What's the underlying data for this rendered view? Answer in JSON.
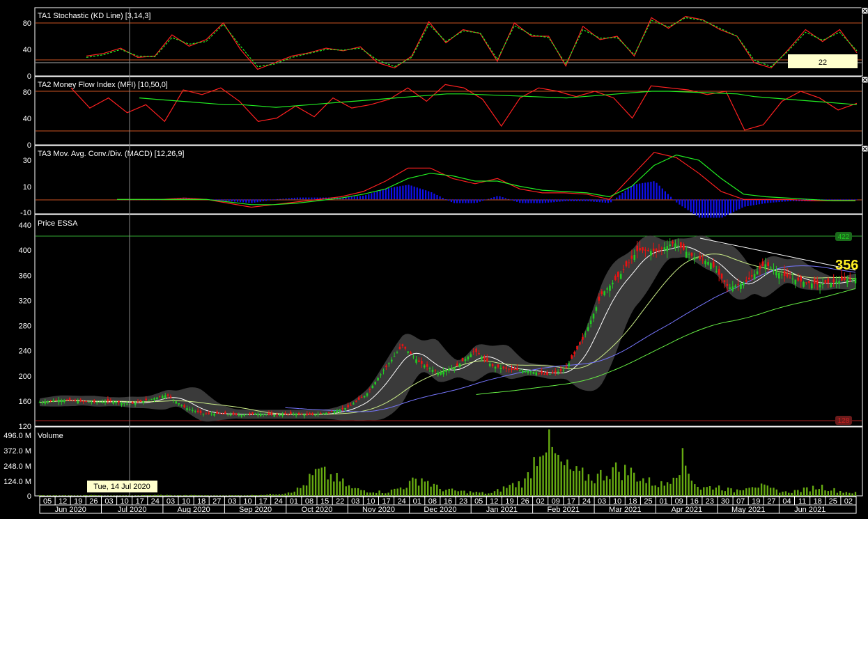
{
  "panels": {
    "stoch": {
      "title": "TA1 Stochastic (KD Line) [3,14,3]",
      "ticks": [
        "80",
        "40",
        "0"
      ],
      "readout": "22"
    },
    "mfi": {
      "title": "TA2 Money Flow Index (MFI) [10,50,0]",
      "ticks": [
        "80",
        "40",
        "0"
      ]
    },
    "macd": {
      "title": "TA3 Mov. Avg. Conv./Div. (MACD) [12,26,9]",
      "ticks": [
        "30",
        "10",
        "-10"
      ]
    },
    "price": {
      "title": "Price ESSA",
      "ticks": [
        "440",
        "400",
        "360",
        "320",
        "280",
        "240",
        "200",
        "160",
        "120"
      ],
      "badge_high": "422",
      "badge_low": "128",
      "last": "356"
    },
    "volume": {
      "title": "Volume",
      "ticks": [
        "496.0 M",
        "372.0 M",
        "248.0 M",
        "124.0 M",
        "0"
      ]
    }
  },
  "crosshair_label": "Tue, 14 Jul 2020",
  "xaxis": {
    "days": [
      "05",
      "12",
      "19",
      "26",
      "03",
      "10",
      "17",
      "24",
      "03",
      "10",
      "18",
      "27",
      "03",
      "10",
      "17",
      "24",
      "01",
      "08",
      "15",
      "22",
      "03",
      "10",
      "17",
      "24",
      "01",
      "08",
      "16",
      "23",
      "05",
      "12",
      "19",
      "26",
      "02",
      "09",
      "17",
      "24",
      "03",
      "10",
      "18",
      "25",
      "01",
      "09",
      "16",
      "23",
      "30",
      "07",
      "19",
      "27",
      "04",
      "11",
      "18",
      "25",
      "02"
    ],
    "months": [
      "Jun 2020",
      "Jul 2020",
      "Aug 2020",
      "Sep 2020",
      "Oct 2020",
      "Nov 2020",
      "Dec 2020",
      "Jan 2021",
      "Feb 2021",
      "Mar 2021",
      "Apr 2021",
      "May 2021",
      "Jun 2021"
    ]
  },
  "colors": {
    "up": "#22cc22",
    "down": "#ee1111",
    "k": "#ff2020",
    "d": "#22ee22",
    "hist": "#1010ee",
    "band": "#444444",
    "ma_white": "#ffffff",
    "ma_green": "#66ee44",
    "ma_blue": "#7777ff",
    "level": "#cc5522",
    "vol": "#66aa11"
  },
  "chart_data": [
    {
      "type": "line",
      "title": "TA1 Stochastic (KD Line) [3,14,3]",
      "ylim": [
        0,
        100
      ],
      "series": [
        {
          "name": "K",
          "values": [
            30,
            34,
            42,
            28,
            30,
            62,
            45,
            55,
            80,
            40,
            10,
            20,
            30,
            35,
            42,
            38,
            44,
            20,
            12,
            30,
            82,
            50,
            70,
            64,
            22,
            80,
            60,
            60,
            15,
            75,
            55,
            60,
            30,
            88,
            72,
            90,
            85,
            70,
            60,
            20,
            12,
            40,
            70,
            52,
            70,
            35
          ]
        },
        {
          "name": "D",
          "values": [
            28,
            32,
            40,
            30,
            29,
            58,
            48,
            52,
            78,
            45,
            14,
            18,
            28,
            34,
            40,
            39,
            42,
            24,
            14,
            28,
            78,
            52,
            68,
            65,
            25,
            76,
            62,
            58,
            18,
            70,
            57,
            58,
            32,
            84,
            74,
            88,
            84,
            72,
            60,
            24,
            14,
            38,
            66,
            54,
            66,
            38
          ]
        }
      ]
    },
    {
      "type": "line",
      "title": "TA2 Money Flow Index (MFI) [10,50,0]",
      "ylim": [
        0,
        100
      ],
      "series": [
        {
          "name": "MFI",
          "values": [
            85,
            55,
            70,
            48,
            60,
            35,
            82,
            75,
            85,
            65,
            35,
            40,
            58,
            42,
            70,
            55,
            60,
            68,
            85,
            65,
            90,
            85,
            68,
            28,
            70,
            85,
            80,
            72,
            80,
            70,
            40,
            88,
            85,
            82,
            75,
            80,
            22,
            30,
            65,
            80,
            70,
            52,
            62
          ]
        },
        {
          "name": "Signal",
          "values": [
            70,
            68,
            66,
            64,
            62,
            60,
            60,
            58,
            56,
            58,
            60,
            62,
            64,
            66,
            68,
            70,
            72,
            74,
            76,
            76,
            75,
            74,
            73,
            72,
            71,
            70,
            72,
            74,
            76,
            78,
            80,
            80,
            79,
            78,
            77,
            76,
            72,
            70,
            68,
            66,
            64,
            62,
            60
          ]
        }
      ]
    },
    {
      "type": "line",
      "title": "TA3 Mov. Avg. Conv./Div. (MACD) [12,26,9]",
      "ylim": [
        -10,
        40
      ],
      "series": [
        {
          "name": "MACD",
          "values": [
            0,
            0,
            0,
            1,
            0,
            -3,
            -6,
            -4,
            -2,
            0,
            2,
            6,
            14,
            24,
            24,
            16,
            12,
            16,
            8,
            5,
            5,
            4,
            0,
            18,
            36,
            32,
            20,
            6,
            0,
            0,
            0,
            -1,
            -1,
            -1
          ]
        },
        {
          "name": "Signal",
          "values": [
            0,
            0,
            0,
            0,
            0,
            -2,
            -4,
            -4,
            -3,
            -1,
            1,
            4,
            8,
            16,
            20,
            18,
            14,
            14,
            10,
            7,
            6,
            5,
            2,
            10,
            26,
            34,
            30,
            16,
            4,
            2,
            1,
            0,
            -1,
            -1
          ]
        }
      ]
    },
    {
      "type": "line",
      "title": "Price ESSA",
      "ylim": [
        120,
        440
      ],
      "series": [
        {
          "name": "Close",
          "values": [
            158,
            162,
            160,
            158,
            160,
            155,
            162,
            170,
            150,
            140,
            140,
            138,
            140,
            138,
            140,
            138,
            142,
            150,
            170,
            210,
            248,
            220,
            205,
            215,
            240,
            215,
            210,
            208,
            202,
            210,
            260,
            330,
            360,
            400,
            398,
            412,
            390,
            380,
            340,
            350,
            378,
            360,
            350,
            345,
            350,
            356
          ]
        }
      ]
    },
    {
      "type": "bar",
      "title": "Volume",
      "ylim": [
        0,
        496
      ],
      "values": [
        5,
        4,
        3,
        6,
        2,
        3,
        5,
        8,
        4,
        6,
        3,
        4,
        5,
        10,
        20,
        60,
        200,
        150,
        60,
        40,
        30,
        80,
        150,
        60,
        40,
        30,
        20,
        80,
        120,
        480,
        260,
        180,
        150,
        220,
        200,
        120,
        90,
        300,
        60,
        80,
        40,
        100,
        60,
        30,
        50,
        80,
        40,
        25
      ]
    }
  ]
}
